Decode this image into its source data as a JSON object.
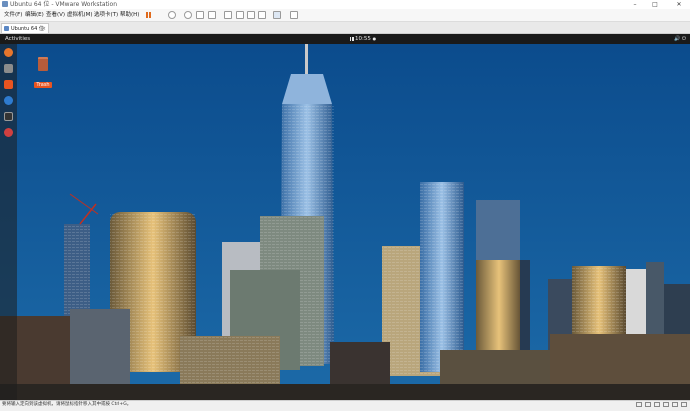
{
  "window": {
    "title": "Ubuntu 64 位 - VMware Workstation",
    "controls": {
      "minimize": "–",
      "maximize": "□",
      "close": "✕"
    }
  },
  "menubar": {
    "items": [
      "文件(F)",
      "编辑(E)",
      "查看(V)",
      "虚拟机(M)",
      "选项卡(T)",
      "帮助(H)"
    ]
  },
  "toolbar": {
    "icons": [
      "pause-icon",
      "send-keys-icon",
      "snapshot-icon",
      "revert-snapshot-icon",
      "manage-snapshots-icon",
      "sidebar-icon",
      "thumbnail-icon",
      "fullscreen-icon",
      "unity-icon",
      "console-view-icon",
      "stretch-icon"
    ]
  },
  "tabs": [
    {
      "label": "Ubuntu 64 位",
      "close": "×"
    }
  ],
  "guest": {
    "topbar": {
      "activities": "Activities",
      "clock": "10:55",
      "status_dot": "●",
      "system_icons": "🔊 ⏻"
    },
    "desktop": {
      "trash_label": "Trash"
    },
    "dock": {
      "apps": [
        "firefox-icon",
        "files-icon",
        "software-center-icon",
        "help-icon",
        "terminal-icon",
        "disc-icon"
      ]
    }
  },
  "statusbar": {
    "text": "要将输入定向到该虚拟机，请将鼠标指针移入其中或按 Ctrl+G。"
  },
  "colors": {
    "sky_top": "#0b4b8c",
    "sky_bottom": "#1c6aa8",
    "ubuntu_orange": "#e95420"
  }
}
